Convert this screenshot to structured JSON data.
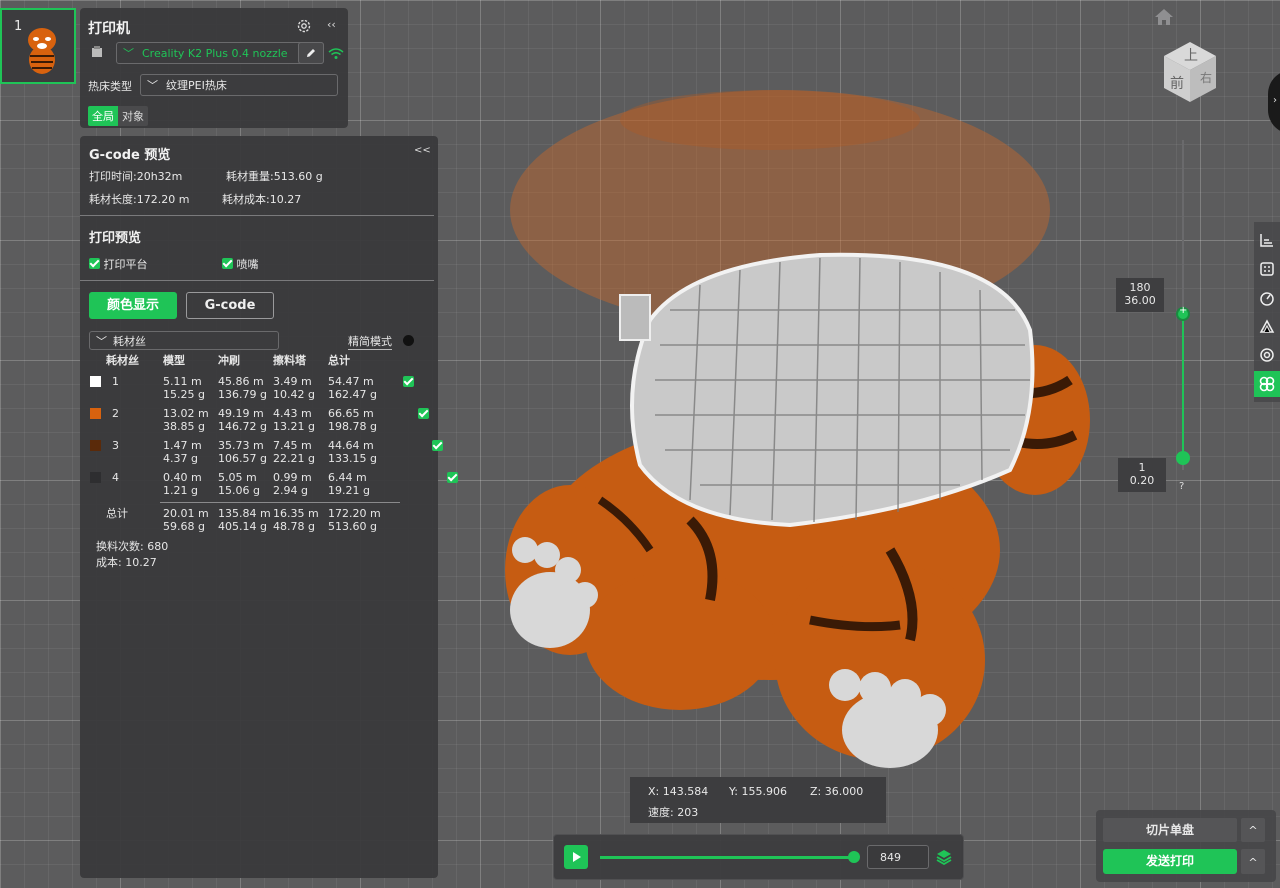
{
  "plate": {
    "number": "1"
  },
  "printer": {
    "title": "打印机",
    "collapse": "‹‹",
    "name": "Creality K2 Plus 0.4 nozzle",
    "bed_label": "热床类型",
    "bed_value": "纹理PEI热床",
    "scope_global": "全局",
    "scope_object": "对象"
  },
  "gcode_preview": {
    "title": "G-code 预览",
    "collapse": "<<",
    "print_time": "打印时间:20h32m",
    "filament_weight": "耗材重量:513.60 g",
    "filament_length": "耗材长度:172.20 m",
    "filament_cost": "耗材成本:10.27",
    "print_preview_title": "打印预览",
    "show_plate": "打印平台",
    "show_nozzle": "喷嘴",
    "color_display_btn": "颜色显示",
    "gcode_btn": "G-code",
    "filament_select": "耗材丝",
    "compact_mode": "精简模式",
    "headers": [
      "耗材丝",
      "模型",
      "冲刷",
      "擦料塔",
      "总计"
    ],
    "rows": [
      {
        "id": "1",
        "color": "#ffffff",
        "model": [
          "5.11 m",
          "15.25 g"
        ],
        "flush": [
          "45.86 m",
          "136.79 g"
        ],
        "tower": [
          "3.49 m",
          "10.42 g"
        ],
        "total": [
          "54.47 m",
          "162.47 g"
        ]
      },
      {
        "id": "2",
        "color": "#d8620e",
        "model": [
          "13.02 m",
          "38.85 g"
        ],
        "flush": [
          "49.19 m",
          "146.72 g"
        ],
        "tower": [
          "4.43 m",
          "13.21 g"
        ],
        "total": [
          "66.65 m",
          "198.78 g"
        ]
      },
      {
        "id": "3",
        "color": "#5a2a0a",
        "model": [
          "1.47 m",
          "4.37 g"
        ],
        "flush": [
          "35.73 m",
          "106.57 g"
        ],
        "tower": [
          "7.45 m",
          "22.21 g"
        ],
        "total": [
          "44.64 m",
          "133.15 g"
        ]
      },
      {
        "id": "4",
        "color": "#2e2e30",
        "model": [
          "0.40 m",
          "1.21 g"
        ],
        "flush": [
          "5.05 m",
          "15.06 g"
        ],
        "tower": [
          "0.99 m",
          "2.94 g"
        ],
        "total": [
          "6.44 m",
          "19.21 g"
        ]
      }
    ],
    "total_label": "总计",
    "totals": {
      "model": [
        "20.01 m",
        "59.68 g"
      ],
      "flush": [
        "135.84 m",
        "405.14 g"
      ],
      "tower": [
        "16.35 m",
        "48.78 g"
      ],
      "total": [
        "172.20 m",
        "513.60 g"
      ]
    },
    "changes_label": "换料次数:",
    "changes_value": "680",
    "cost_label": "成本:",
    "cost_value": "10.27"
  },
  "coords": {
    "x": "X: 143.584",
    "y": "Y: 155.906",
    "z": "Z: 36.000",
    "speed": "速度: 203"
  },
  "playback": {
    "value": "849",
    "progress": 1.0
  },
  "layers": {
    "top_num": "180",
    "top_height": "36.00",
    "bottom_num": "1",
    "bottom_height": "0.20",
    "help": "?"
  },
  "view_cube": {
    "top": "上",
    "front": "前",
    "right": "右"
  },
  "actions": {
    "slice": "切片单盘",
    "send": "发送打印",
    "expand": "^"
  },
  "icons": [
    "home-icon",
    "settings-gear-icon",
    "edit-pencil-icon",
    "wifi-icon",
    "play-icon",
    "layers-icon"
  ]
}
